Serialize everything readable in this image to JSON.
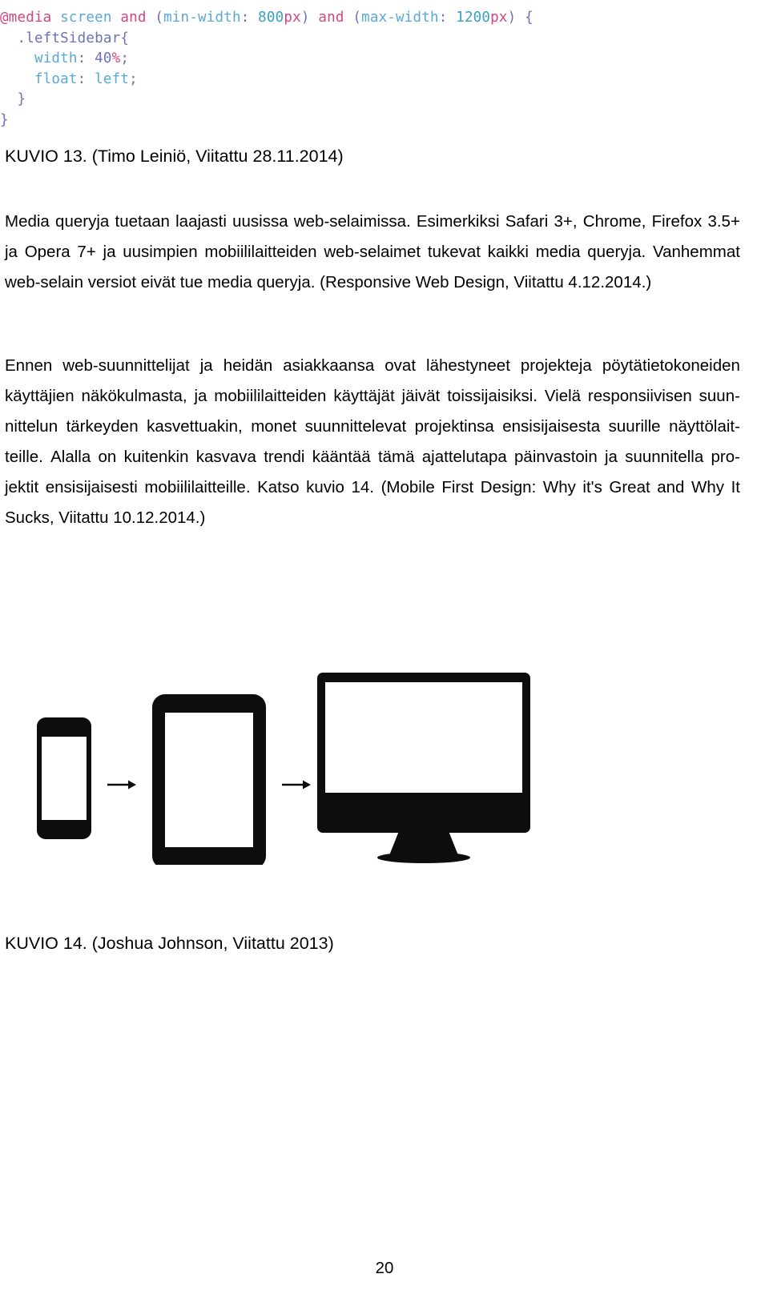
{
  "document": {
    "page_number": "20",
    "language": "fi"
  },
  "code_figure": {
    "name": "css-media-query-snippet",
    "lines": [
      {
        "tokens": [
          {
            "text": "@media",
            "type": "at"
          },
          {
            "text": " ",
            "type": "plain"
          },
          {
            "text": "screen",
            "type": "kw"
          },
          {
            "text": " ",
            "type": "plain"
          },
          {
            "text": "and",
            "type": "unit"
          },
          {
            "text": " ",
            "type": "plain"
          },
          {
            "text": "(",
            "type": "punct"
          },
          {
            "text": "min-width",
            "type": "kw"
          },
          {
            "text": ": ",
            "type": "punct"
          },
          {
            "text": "800",
            "type": "num"
          },
          {
            "text": "px",
            "type": "unit"
          },
          {
            "text": ")",
            "type": "punct"
          },
          {
            "text": " ",
            "type": "plain"
          },
          {
            "text": "and",
            "type": "unit"
          },
          {
            "text": " ",
            "type": "plain"
          },
          {
            "text": "(",
            "type": "punct"
          },
          {
            "text": "max-width",
            "type": "kw"
          },
          {
            "text": ": ",
            "type": "punct"
          },
          {
            "text": "1200",
            "type": "num"
          },
          {
            "text": "px",
            "type": "unit"
          },
          {
            "text": ")",
            "type": "punct"
          },
          {
            "text": " ",
            "type": "plain"
          },
          {
            "text": "{",
            "type": "brace"
          }
        ]
      },
      {
        "tokens": [
          {
            "text": "  ",
            "type": "plain"
          },
          {
            "text": ".leftSidebar",
            "type": "sel"
          },
          {
            "text": "{",
            "type": "brace"
          }
        ]
      },
      {
        "tokens": [
          {
            "text": "    ",
            "type": "plain"
          },
          {
            "text": "width",
            "type": "prop"
          },
          {
            "text": ": ",
            "type": "punct"
          },
          {
            "text": "40",
            "type": "sel"
          },
          {
            "text": "%",
            "type": "unit"
          },
          {
            "text": ";",
            "type": "punct"
          }
        ]
      },
      {
        "tokens": [
          {
            "text": "    ",
            "type": "plain"
          },
          {
            "text": "float",
            "type": "prop"
          },
          {
            "text": ": ",
            "type": "punct"
          },
          {
            "text": "left",
            "type": "val"
          },
          {
            "text": ";",
            "type": "punct"
          }
        ]
      },
      {
        "tokens": [
          {
            "text": "  ",
            "type": "plain"
          },
          {
            "text": "}",
            "type": "brace"
          }
        ]
      },
      {
        "tokens": [
          {
            "text": "}",
            "type": "brace"
          }
        ]
      }
    ],
    "raw_text": "@media screen and (min-width: 800px) and (max-width: 1200px) {\n  .leftSidebar{\n    width: 40%;\n    float: left;\n  }\n}",
    "colors": {
      "at_rule": "#d6457f",
      "keyword": "#5aa8d6",
      "selector": "#6b73b8",
      "number": "#3a9fc4",
      "unit": "#d6457f",
      "punctuation": "#6b73b8"
    }
  },
  "captions": {
    "kuvio13": "KUVIO 13. (Timo Leiniö, Viitattu 28.11.2014)",
    "kuvio14": "KUVIO 14. (Joshua Johnson, Viitattu 2013)"
  },
  "paragraph_1": {
    "full_text": "Media queryja tuetaan laajasti uusissa web-selaimissa. Esimerkiksi Safari 3+, Chrome, Firefox 3.5+ ja Opera 7+ ja uusimpien mobiililaitteiden web-selaimet tukevat kaikki media queryja. Vanhemmat web-selain versiot eivät tue media queryja. (Responsive Web Design, Viitattu 4.12.2014.)",
    "lines": [
      {
        "justified": true,
        "words": [
          "Media",
          "queryja",
          "tuetaan",
          "laajasti",
          "uusissa",
          "web-selaimissa.",
          "Esimerkiksi",
          "Safari",
          "3+,",
          "Chrome,",
          "Firefox",
          "3.5+"
        ]
      },
      {
        "justified": true,
        "words": [
          "ja",
          "Opera",
          "7+",
          "ja",
          "uusimpien",
          "mobiililaitteiden",
          "web-selaimet",
          "tukevat",
          "kaikki",
          "media",
          "queryja.",
          "Vanhemmat"
        ]
      },
      {
        "justified": false,
        "text": "web-selain versiot eivät tue media queryja. (Responsive Web Design, Viitattu 4.12.2014.)"
      }
    ]
  },
  "paragraph_2": {
    "full_text": "Ennen web-suunnittelijat ja heidän asiakkaansa ovat lähestyneet projekteja pöytätietokoneiden käyttäjien näkökulmasta, ja mobiililaitteiden käyttäjät jäivät toissijaisiksi. Vielä responsiivisen suunnittelun tärkeyden kasvettuakin, monet suunnittelevat projektinsa ensisijaisesta suurille näyttölaitteille. Alalla on kuitenkin kasvava trendi kääntää tämä ajattelutapa päinvastoin ja suunnitella projektit ensisijaisesti mobiililaitteille. Katso kuvio 14. (Mobile First Design: Why it's Great and Why It Sucks, Viitattu 10.12.2014.)",
    "lines": [
      {
        "justified": true,
        "words": [
          "Ennen",
          "web-suunnittelijat",
          "ja",
          "heidän",
          "asiakkaansa",
          "ovat",
          "lähestyneet",
          "projekteja",
          "pöytätietokoneiden"
        ]
      },
      {
        "justified": true,
        "words": [
          "käyttäjien",
          "näkökulmasta,",
          "ja",
          "mobiililaitteiden",
          "käyttäjät",
          "jäivät",
          "toissijaisiksi.",
          "Vielä",
          "responsiivisen",
          "suun-"
        ]
      },
      {
        "justified": true,
        "words": [
          "nittelun",
          "tärkeyden",
          "kasvettuakin,",
          "monet",
          "suunnittelevat",
          "projektinsa",
          "ensisijaisesta",
          "suurille",
          "näyttölait-"
        ]
      },
      {
        "justified": true,
        "words": [
          "teille.",
          "Alalla",
          "on",
          "kuitenkin",
          "kasvava",
          "trendi",
          "kääntää",
          "tämä",
          "ajattelutapa",
          "päinvastoin",
          "ja",
          "suunnitella",
          "pro-"
        ]
      },
      {
        "justified": true,
        "words": [
          "jektit",
          "ensisijaisesti",
          "mobiililaitteille.",
          "Katso",
          "kuvio",
          "14.",
          "(Mobile",
          "First",
          "Design:",
          "Why",
          "it's",
          "Great",
          "and",
          "Why",
          "It"
        ]
      },
      {
        "justified": false,
        "text": "Sucks, Viitattu 10.12.2014.)"
      }
    ]
  },
  "device_figure": {
    "name": "responsive-devices-progression",
    "devices": [
      "smartphone",
      "tablet",
      "desktop-monitor"
    ],
    "arrows": 2,
    "color": "#0d0d0d"
  }
}
